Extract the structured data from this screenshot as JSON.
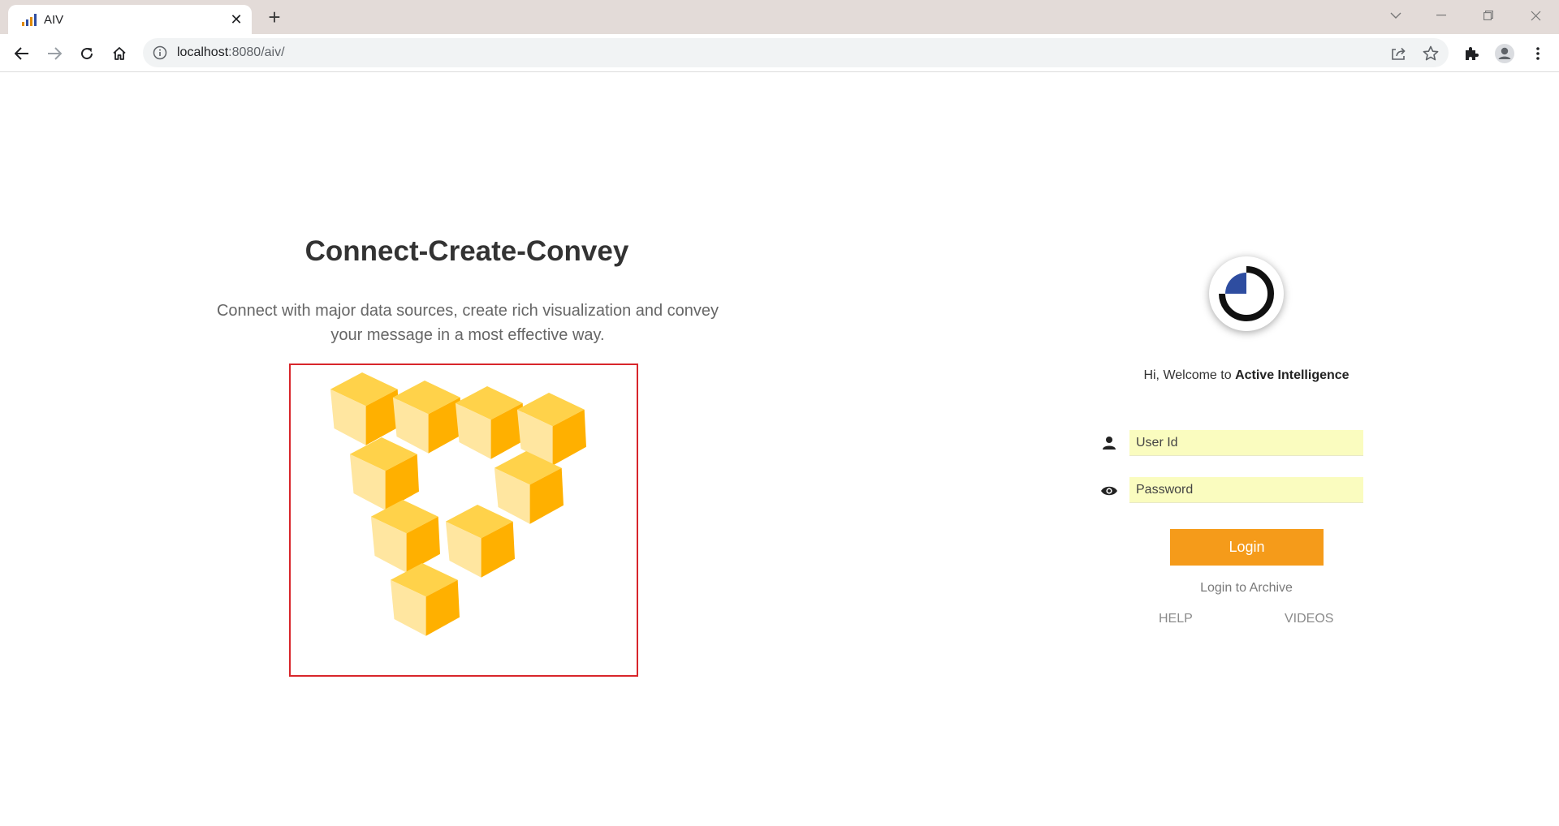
{
  "browser": {
    "tab": {
      "title": "AIV",
      "close_glyph": "✕",
      "favicon": "aiv-bars-icon"
    },
    "new_tab_glyph": "+",
    "address_bar": {
      "host": "localhost",
      "rest": ":8080/aiv/"
    },
    "icons": {
      "back": "back-arrow-icon",
      "forward": "forward-arrow-icon",
      "reload": "reload-icon",
      "home": "home-icon",
      "site_info": "info-icon",
      "share": "share-icon",
      "bookmark": "star-icon",
      "extensions": "puzzle-icon",
      "profile": "profile-icon",
      "menu": "kebab-menu-icon"
    }
  },
  "hero": {
    "title": "Connect-Create-Convey",
    "subtitle_line1": "Connect with major data sources, create rich visualization and convey",
    "subtitle_line2": "your message in a most effective way.",
    "image": "impossible-triangle-cubes-icon",
    "frame_color": "#d8262b"
  },
  "login": {
    "welcome_prefix": "Hi, Welcome to ",
    "welcome_brand": "Active Intelligence",
    "user_placeholder": "User Id",
    "password_placeholder": "Password",
    "user_icon": "user-icon",
    "password_icon": "eye-icon",
    "login_label": "Login",
    "archive_label": "Login to Archive",
    "help_label": "HELP",
    "videos_label": "VIDEOS"
  },
  "colors": {
    "accent": "#f59b1a",
    "field_bg": "#fafcbf",
    "logo_blue": "#2e4da0",
    "tabstrip": "#e3dbd8"
  }
}
